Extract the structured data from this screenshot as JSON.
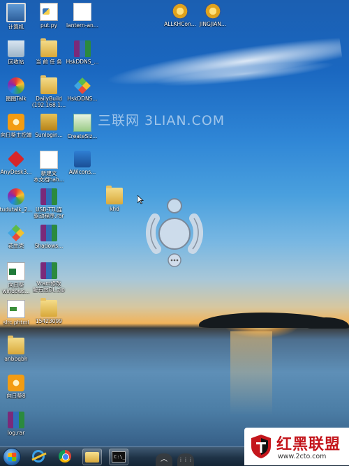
{
  "watermark": "三联网 3LIAN.COM",
  "desktop_icons": [
    {
      "id": "computer",
      "label": "计算机",
      "icon": "computer-icon"
    },
    {
      "id": "put-py",
      "label": "put.py",
      "icon": "python-file-icon"
    },
    {
      "id": "lantern",
      "label": "lantern-an...",
      "icon": "document-icon"
    },
    {
      "id": "allkh",
      "label": "ALLKHCon...",
      "icon": "gear-app-icon"
    },
    {
      "id": "jingjian",
      "label": "JINGJIAN...",
      "icon": "gear-app-icon"
    },
    {
      "id": "recycle",
      "label": "回收站",
      "icon": "recycle-bin-icon"
    },
    {
      "id": "task",
      "label": "当 前 任 务",
      "icon": "folder-icon"
    },
    {
      "id": "hskddns-rar",
      "label": "HskDDNS_...",
      "icon": "rar-archive-icon"
    },
    {
      "id": "tutalk",
      "label": "图图Talk",
      "icon": "chat-app-icon"
    },
    {
      "id": "dailybuild",
      "label": "DailyBuild\n(192.168.1...",
      "icon": "folder-icon"
    },
    {
      "id": "hskddns",
      "label": "HskDDNS...",
      "icon": "cube-app-icon"
    },
    {
      "id": "sunlogin-ctrl",
      "label": "向日葵主控端",
      "icon": "sunflower-icon"
    },
    {
      "id": "sunlogin",
      "label": "Sunlogin...",
      "icon": "pin-app-icon"
    },
    {
      "id": "createsize",
      "label": "CreateSiz...",
      "icon": "app-window-icon"
    },
    {
      "id": "anydesk",
      "label": "AnyDesk3...",
      "icon": "anydesk-icon"
    },
    {
      "id": "newtext",
      "label": "新建文\n本文档hah...",
      "icon": "document-icon"
    },
    {
      "id": "awicons",
      "label": "AWicons...",
      "icon": "app-window-icon"
    },
    {
      "id": "tudutalk",
      "label": "tudutalk_2...",
      "icon": "chat-app-icon"
    },
    {
      "id": "usb-ttl",
      "label": "USB-TTL连\n驱动程序.rar",
      "icon": "rar-archive-icon"
    },
    {
      "id": "khd",
      "label": "khd",
      "icon": "folder-icon"
    },
    {
      "id": "huashengke",
      "label": "花生壳",
      "icon": "cube-app-icon"
    },
    {
      "id": "shadows",
      "label": "Shadows...",
      "icon": "rar-archive-icon"
    },
    {
      "id": "sunlogin-win",
      "label": "向日葵\nwindows...",
      "icon": "excel-file-icon"
    },
    {
      "id": "vram",
      "label": "Vram修改\n解有效DL.zip",
      "icon": "rar-archive-icon"
    },
    {
      "id": "slrc",
      "label": "slrc.phtml",
      "icon": "html-file-icon"
    },
    {
      "id": "n15423099",
      "label": "15423099",
      "icon": "folder-icon"
    },
    {
      "id": "anbbqbh",
      "label": "anbbqbh",
      "icon": "folder-icon"
    },
    {
      "id": "sunlogin8",
      "label": "向日葵8",
      "icon": "sunflower-icon"
    },
    {
      "id": "log-rar",
      "label": "log.rar",
      "icon": "rar-archive-icon"
    }
  ],
  "taskbar": {
    "items": [
      {
        "name": "start-button",
        "icon": "windows-start-icon"
      },
      {
        "name": "internet-explorer",
        "icon": "ie-icon"
      },
      {
        "name": "chrome",
        "icon": "chrome-icon"
      },
      {
        "name": "file-explorer",
        "icon": "folder-icon"
      },
      {
        "name": "command-prompt",
        "icon": "terminal-icon"
      }
    ],
    "cmd_text": "C:\\_"
  },
  "bottom_controls": {
    "up": "︿",
    "grid": "⋮⋮⋮"
  },
  "logo": {
    "name": "红黑联盟",
    "url": "www.2cto.com"
  }
}
